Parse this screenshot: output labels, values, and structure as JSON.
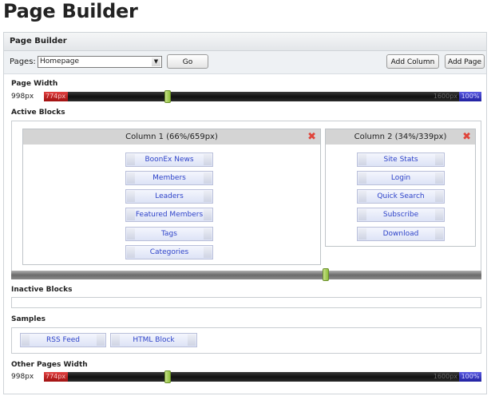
{
  "page_title": "Page Builder",
  "panel": {
    "title": "Page Builder"
  },
  "toolbar": {
    "pages_label": "Pages:",
    "selected_page": "Homepage",
    "go_label": "Go",
    "add_column_label": "Add Column",
    "add_page_label": "Add Page"
  },
  "page_width": {
    "label": "Page Width",
    "value": "998px",
    "min_label": "774px",
    "max_px_label": "1600px",
    "max_pct_label": "100%"
  },
  "active_blocks": {
    "label": "Active Blocks",
    "columns": [
      {
        "title": "Column 1 (66%/659px)",
        "close_icon": "close-icon",
        "blocks": [
          "BoonEx News",
          "Members",
          "Leaders",
          "Featured Members",
          "Tags",
          "Categories"
        ]
      },
      {
        "title": "Column 2 (34%/339px)",
        "close_icon": "close-icon",
        "blocks": [
          "Site Stats",
          "Login",
          "Quick Search",
          "Subscribe",
          "Download"
        ]
      }
    ]
  },
  "inactive_blocks": {
    "label": "Inactive Blocks"
  },
  "samples": {
    "label": "Samples",
    "blocks": [
      "RSS Feed",
      "HTML Block"
    ]
  },
  "other_pages_width": {
    "label": "Other Pages Width",
    "value": "998px",
    "min_label": "774px",
    "max_px_label": "1600px",
    "max_pct_label": "100%"
  },
  "colors": {
    "block_text": "#2e43c9",
    "close_red": "#e0443a",
    "slider_min": "#c02020",
    "slider_max": "#3030c0",
    "handle_green": "#8fbf3b"
  }
}
